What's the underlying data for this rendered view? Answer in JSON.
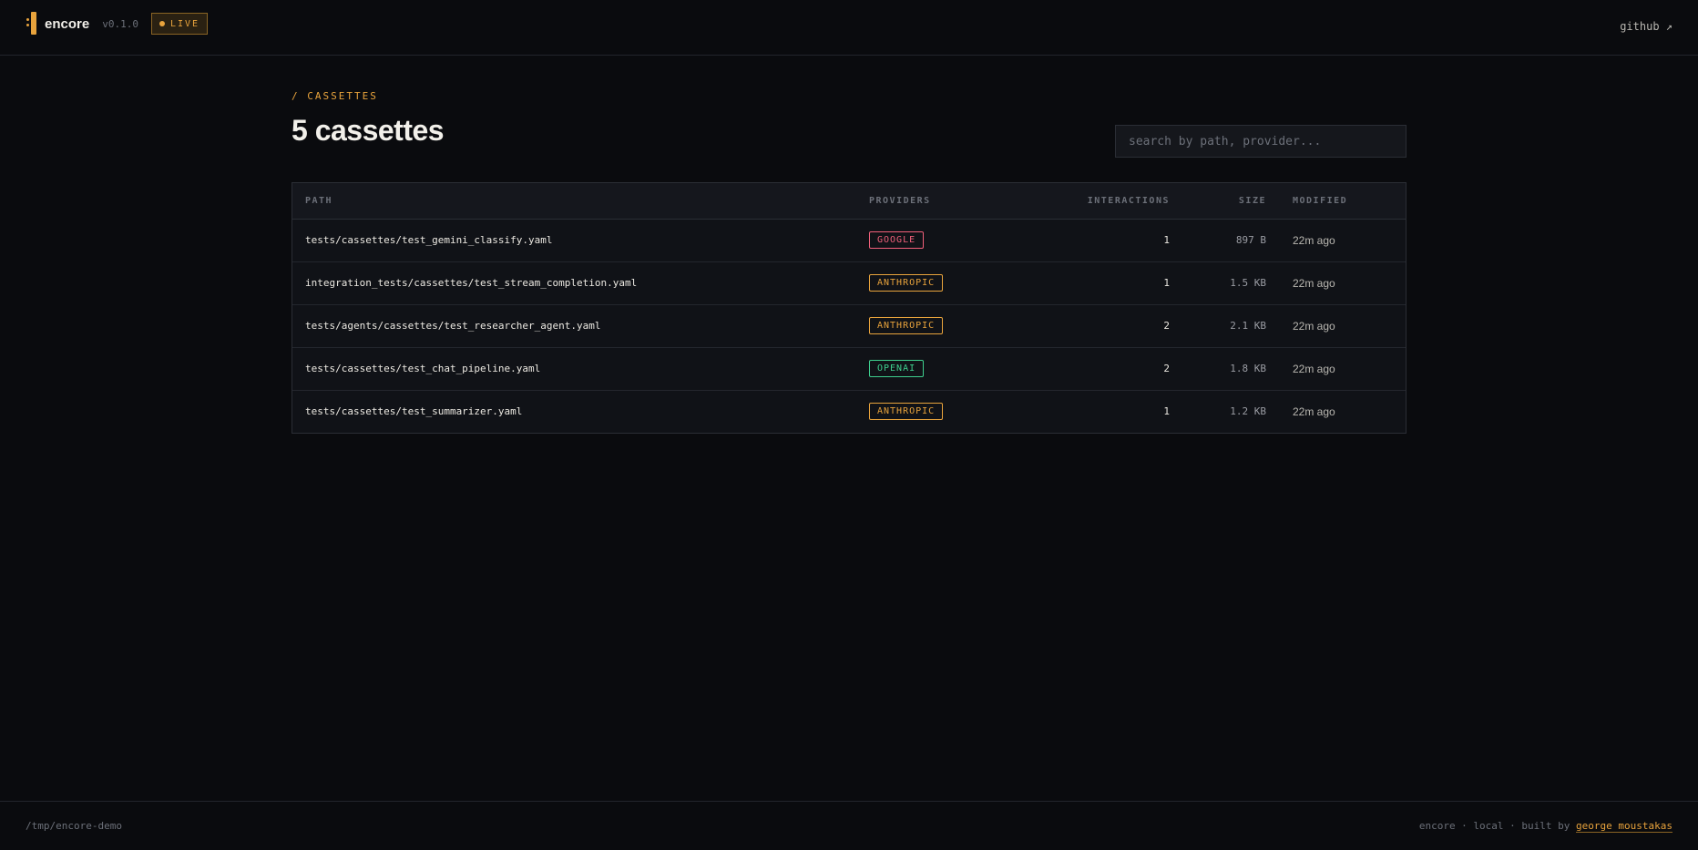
{
  "header": {
    "brand": "encore",
    "version": "v0.1.0",
    "live_label": "LIVE",
    "github_label": "github ↗"
  },
  "page": {
    "breadcrumb": "/ CASSETTES",
    "title": "5 cassettes",
    "search_placeholder": "search by path, provider..."
  },
  "table": {
    "columns": {
      "path": "PATH",
      "providers": "PROVIDERS",
      "interactions": "INTERACTIONS",
      "size": "SIZE",
      "modified": "MODIFIED"
    },
    "rows": [
      {
        "path": "tests/cassettes/test_gemini_classify.yaml",
        "provider": "GOOGLE",
        "interactions": "1",
        "size": "897 B",
        "modified": "22m ago"
      },
      {
        "path": "integration_tests/cassettes/test_stream_completion.yaml",
        "provider": "ANTHROPIC",
        "interactions": "1",
        "size": "1.5 KB",
        "modified": "22m ago"
      },
      {
        "path": "tests/agents/cassettes/test_researcher_agent.yaml",
        "provider": "ANTHROPIC",
        "interactions": "2",
        "size": "2.1 KB",
        "modified": "22m ago"
      },
      {
        "path": "tests/cassettes/test_chat_pipeline.yaml",
        "provider": "OPENAI",
        "interactions": "2",
        "size": "1.8 KB",
        "modified": "22m ago"
      },
      {
        "path": "tests/cassettes/test_summarizer.yaml",
        "provider": "ANTHROPIC",
        "interactions": "1",
        "size": "1.2 KB",
        "modified": "22m ago"
      }
    ]
  },
  "provider_colors": {
    "GOOGLE": "#f0607a",
    "ANTHROPIC": "#e8a33c",
    "OPENAI": "#3ecf8e"
  },
  "footer": {
    "path": "/tmp/encore-demo",
    "credit": "encore · local · built by",
    "author": "george moustakas"
  },
  "colors": {
    "accent": "#e8a33c",
    "background": "#0a0b0e"
  }
}
